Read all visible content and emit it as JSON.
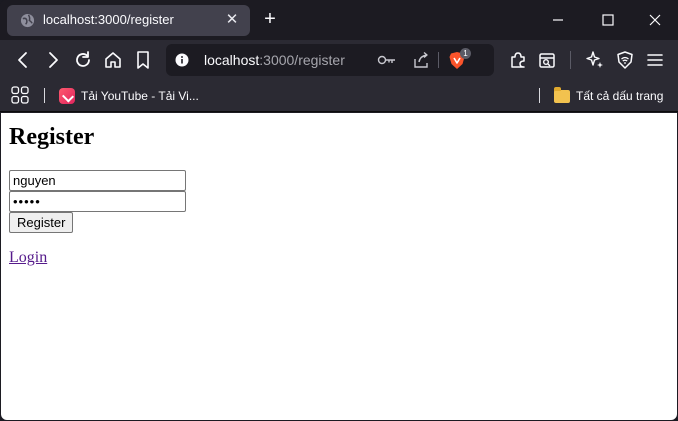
{
  "browser": {
    "tab": {
      "title": "localhost:3000/register"
    },
    "address": {
      "host": "localhost",
      "path": ":3000/register"
    },
    "brave_badge": "1",
    "bookmarks": [
      {
        "label": "Tải YouTube - Tải Vi..."
      }
    ],
    "all_bookmarks": "Tất cả dấu trang"
  },
  "page": {
    "title": "Register",
    "username": {
      "value": "nguyen"
    },
    "password": {
      "value": "•••••"
    },
    "submit_label": "Register",
    "login_link": "Login"
  },
  "colors": {
    "visited_link": "#551a8b",
    "toolbar": "#2b2a33",
    "tab_active": "#42414d"
  }
}
